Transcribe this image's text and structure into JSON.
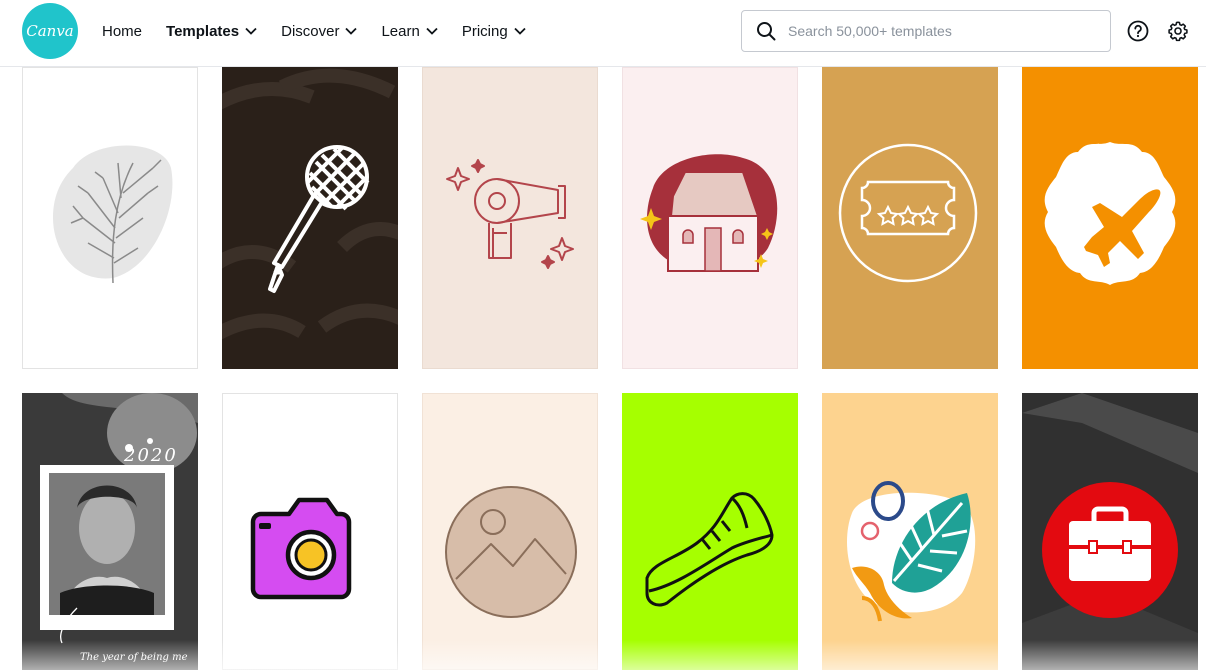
{
  "app": {
    "logo_text": "Canva",
    "brand_color": "#20c4cb"
  },
  "nav": {
    "items": [
      {
        "label": "Home",
        "dropdown": false
      },
      {
        "label": "Templates",
        "dropdown": true,
        "active": true
      },
      {
        "label": "Discover",
        "dropdown": true
      },
      {
        "label": "Learn",
        "dropdown": true
      },
      {
        "label": "Pricing",
        "dropdown": true
      }
    ]
  },
  "search": {
    "placeholder": "Search 50,000+ templates",
    "value": ""
  },
  "header_icons": [
    "help-icon",
    "settings-icon"
  ],
  "templates": {
    "row1": [
      {
        "name": "botanical-sprig",
        "bg": "#ffffff",
        "icon": "plant-sprig-icon"
      },
      {
        "name": "microphone",
        "bg": "#2a2019",
        "icon": "microphone-icon"
      },
      {
        "name": "hair-dryer",
        "bg": "#f3e6dd",
        "icon": "hair-dryer-icon"
      },
      {
        "name": "house",
        "bg": "#fbeff0",
        "icon": "house-icon"
      },
      {
        "name": "ticket",
        "bg": "#d6a252",
        "icon": "ticket-icon"
      },
      {
        "name": "airplane",
        "bg": "#f49000",
        "icon": "airplane-icon"
      }
    ],
    "row2": [
      {
        "name": "photo-frame",
        "bg": "#2b2b2b",
        "icon": "portrait-photo",
        "caption": "The year of being me",
        "year": "2020"
      },
      {
        "name": "camera",
        "bg": "#ffffff",
        "icon": "camera-icon"
      },
      {
        "name": "image-placeholder",
        "bg": "#fbefe4",
        "icon": "landscape-image-icon"
      },
      {
        "name": "sneaker",
        "bg": "#a6ff00",
        "icon": "sneaker-icon"
      },
      {
        "name": "tropical-leaf",
        "bg": "#fdd38f",
        "icon": "monstera-leaf-icon"
      },
      {
        "name": "toolbox",
        "bg": "#262626",
        "icon": "briefcase-icon"
      }
    ]
  }
}
